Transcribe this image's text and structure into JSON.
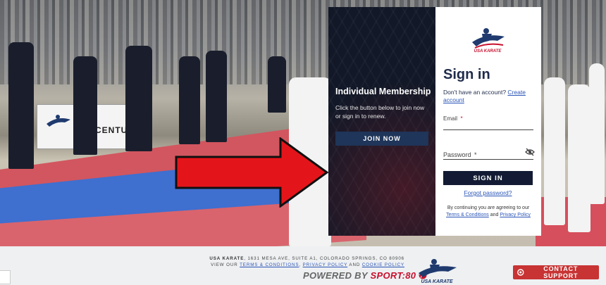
{
  "membership": {
    "title": "Individual Membership",
    "description": "Click the button below to join now or sign in to renew.",
    "join_label": "JOIN NOW"
  },
  "signin": {
    "title": "Sign in",
    "no_account_text": "Don't have an account?",
    "create_account_label": "Create account",
    "email_label": "Email",
    "password_label": "Password",
    "required_mark": "*",
    "button_label": "SIGN IN",
    "forgot_label": "Forgot password?",
    "agree_prefix": "By continuing you are agreeing to our",
    "terms_label": "Terms & Conditions",
    "and_text": "and",
    "privacy_label": "Privacy Policy"
  },
  "brand": {
    "logo_text": "USA KARATE"
  },
  "banner": {
    "text": "CENTUR"
  },
  "footer": {
    "org_name": "USA KARATE",
    "address": ", 1631 MESA AVE, SUITE A1, COLORADO SPRINGS, CO 80906",
    "view_our": "VIEW OUR",
    "terms_label": "TERMS & CONDITIONS",
    "comma": ",",
    "privacy_label": "PRIVACY POLICY",
    "and_text": "AND",
    "cookie_label": "COOKIE POLICY",
    "powered_prefix": "POWERED BY",
    "powered_brand": "SPORT:80",
    "support_label": "CONTACT SUPPORT"
  },
  "colors": {
    "navy": "#121b33",
    "link": "#2a55b8",
    "red": "#c83333"
  }
}
